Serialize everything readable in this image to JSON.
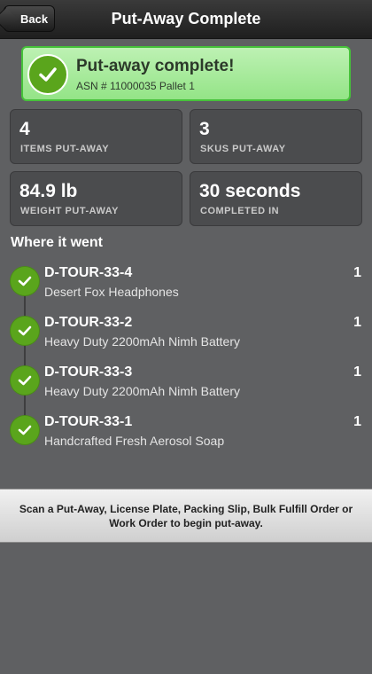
{
  "header": {
    "back_label": "Back",
    "title": "Put-Away Complete"
  },
  "banner": {
    "title": "Put-away complete!",
    "subtitle": "ASN # 11000035 Pallet 1",
    "icon": "check-circle-icon",
    "accent": "#5aa51c"
  },
  "stats": [
    {
      "value": "4",
      "label": "ITEMS PUT-AWAY"
    },
    {
      "value": "3",
      "label": "SKUS PUT-AWAY"
    },
    {
      "value": "84.9 lb",
      "label": "WEIGHT PUT-AWAY"
    },
    {
      "value": "30 seconds",
      "label": "COMPLETED IN"
    }
  ],
  "where_heading": "Where it went",
  "items": [
    {
      "location": "D-TOUR-33-4",
      "description": "Desert Fox Headphones",
      "qty": "1"
    },
    {
      "location": "D-TOUR-33-2",
      "description": "Heavy Duty 2200mAh Nimh Battery",
      "qty": "1"
    },
    {
      "location": "D-TOUR-33-3",
      "description": "Heavy Duty 2200mAh Nimh Battery",
      "qty": "1"
    },
    {
      "location": "D-TOUR-33-1",
      "description": "Handcrafted Fresh Aerosol Soap",
      "qty": "1"
    }
  ],
  "hint": "Scan a Put-Away, License Plate, Packing Slip, Bulk Fulfill Order or Work Order to begin put-away."
}
